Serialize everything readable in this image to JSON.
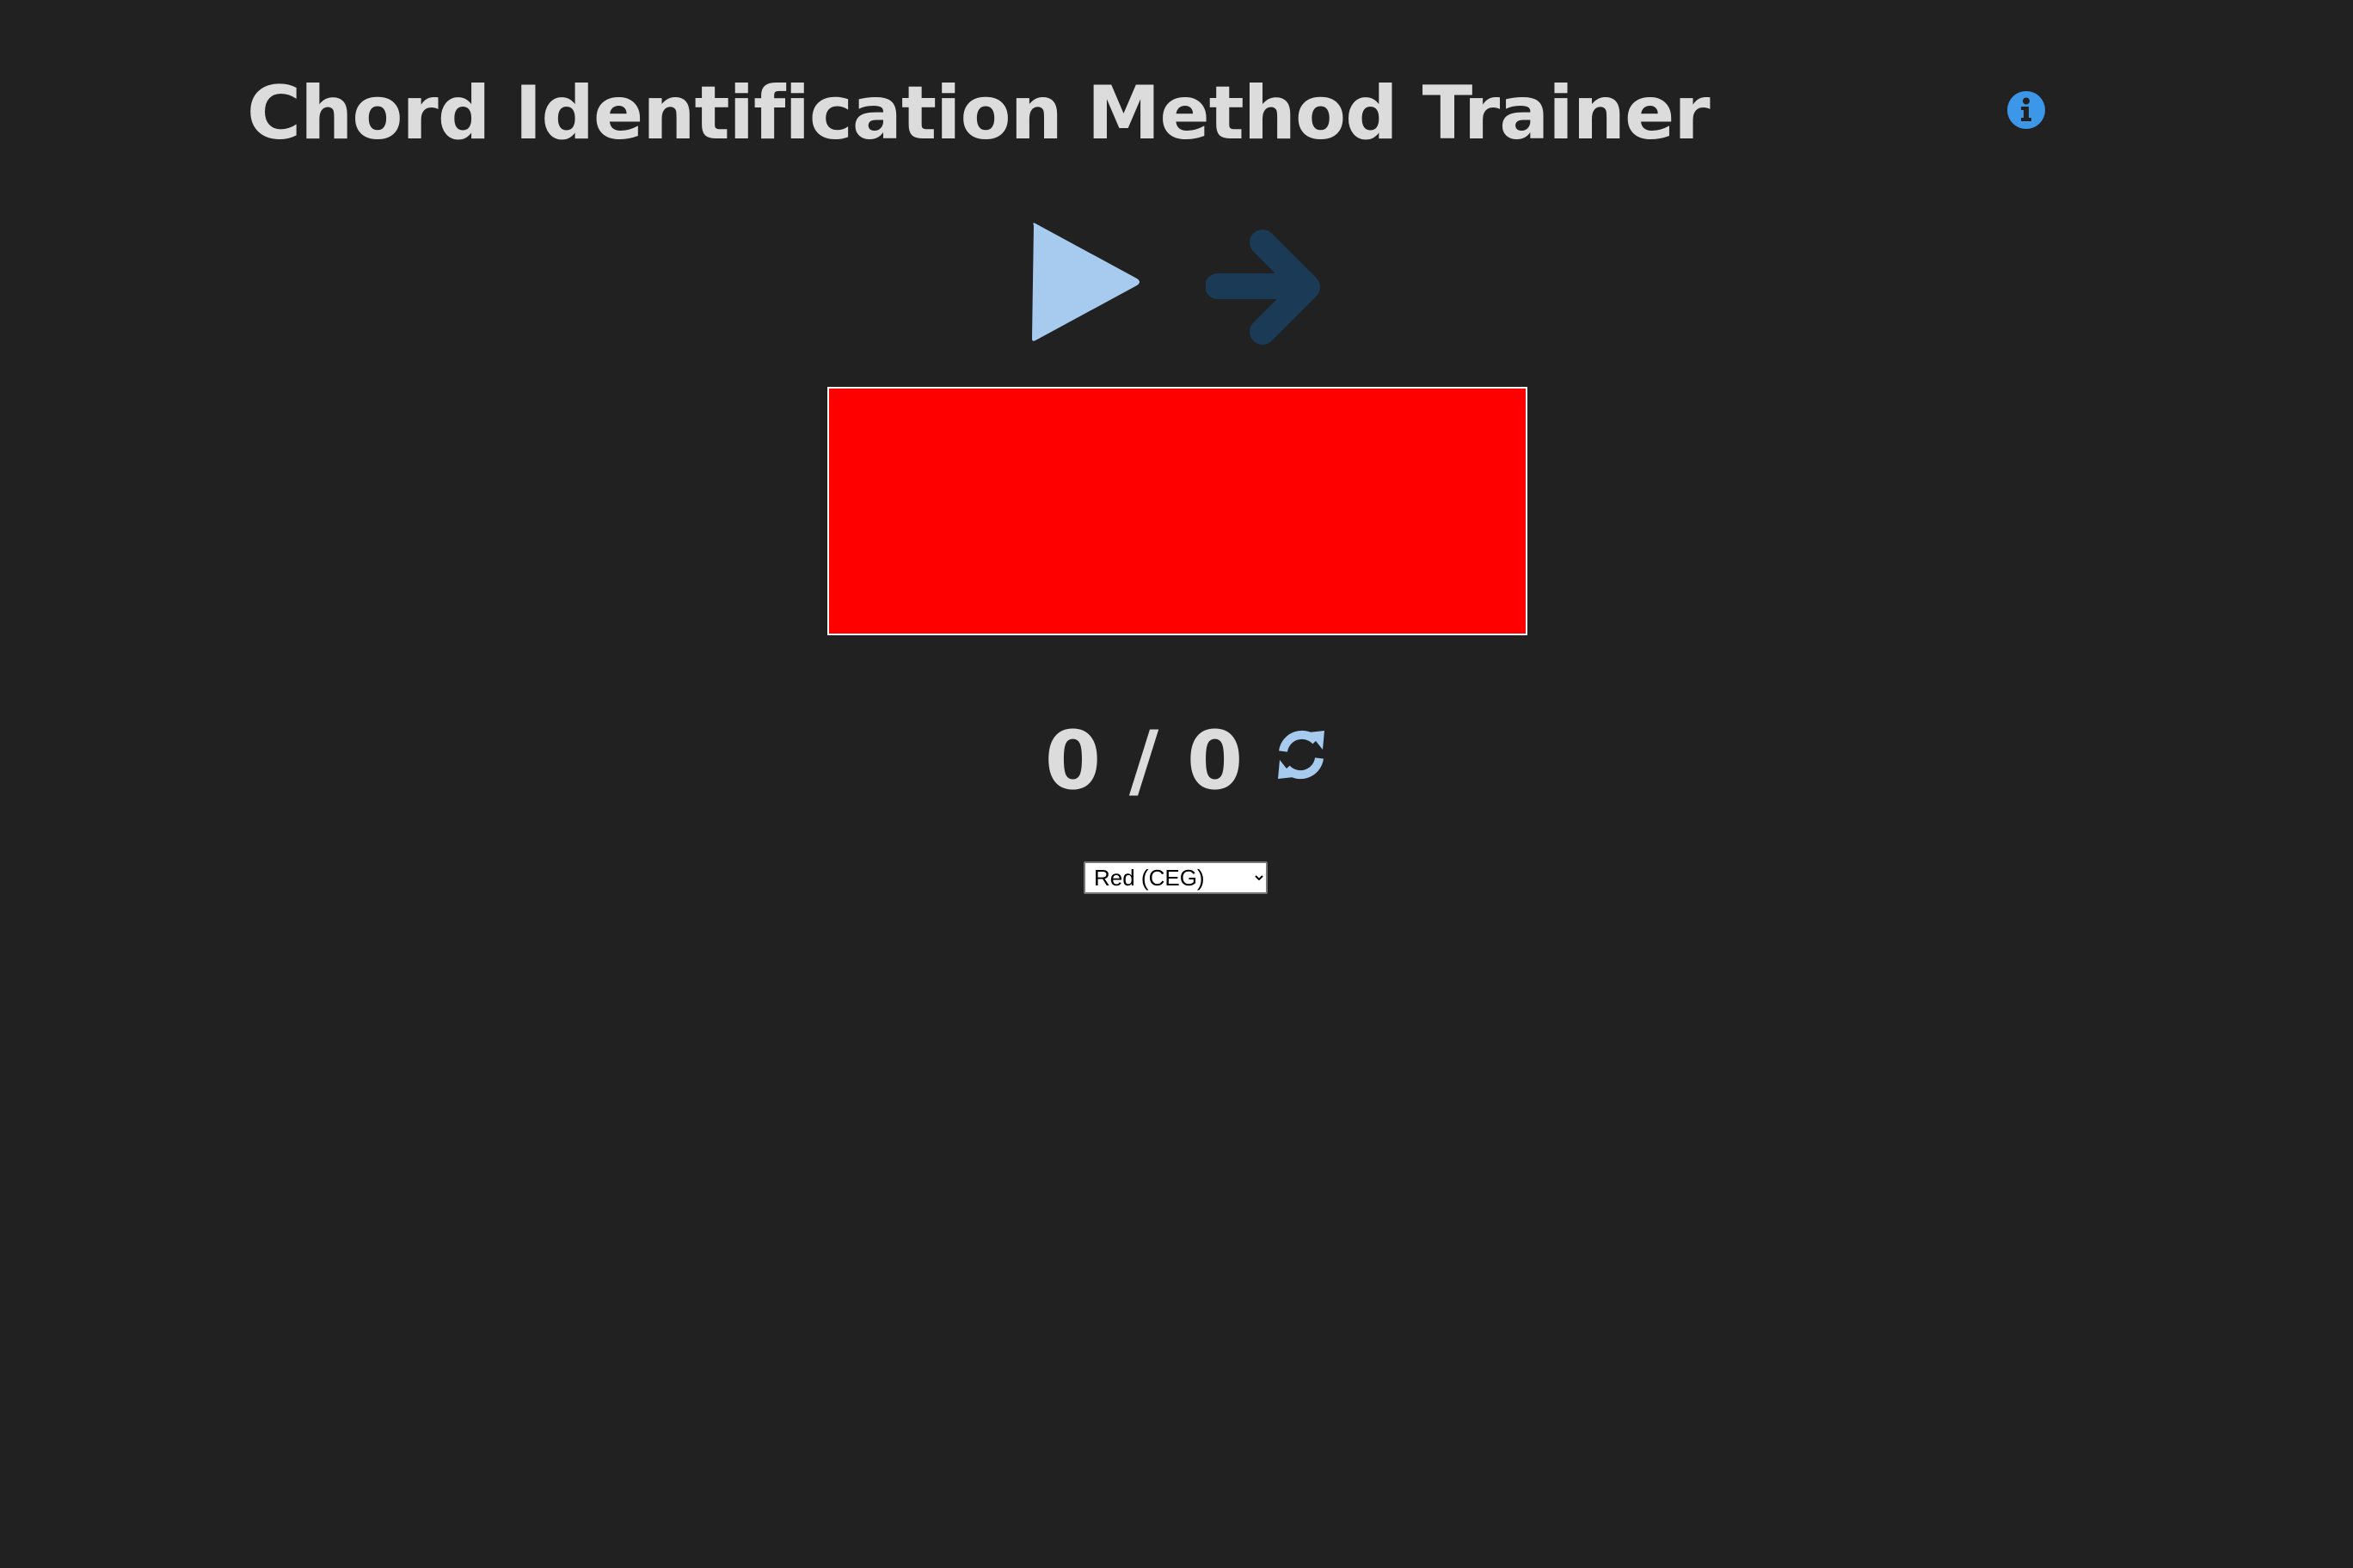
{
  "header": {
    "title": "Chord Identification Method Trainer",
    "info_icon": "info-circle-icon"
  },
  "controls": {
    "play_icon": "play-icon",
    "next_icon": "arrow-right-icon",
    "reset_icon": "refresh-icon"
  },
  "display": {
    "current_color": "#ff0000"
  },
  "score": {
    "text": "0 / 0",
    "correct": 0,
    "total": 0
  },
  "chord_select": {
    "selected": "Red (CEG)",
    "options": [
      "Red (CEG)"
    ]
  },
  "colors": {
    "background": "#212121",
    "text": "#dcdcdc",
    "info_accent": "#3d97e8",
    "play_accent": "#a6cbef",
    "next_accent": "#1b3a56",
    "display_border": "#ffffff"
  }
}
